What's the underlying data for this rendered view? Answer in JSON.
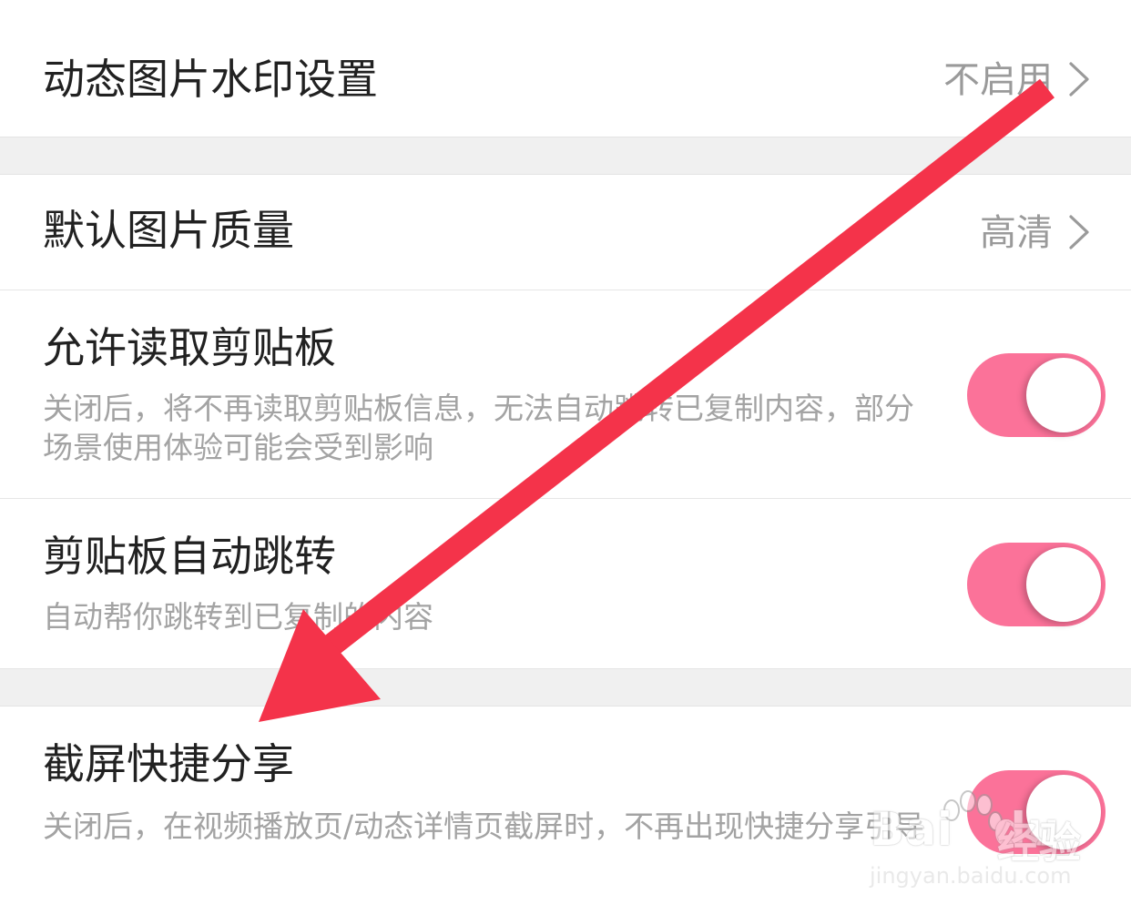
{
  "settings": {
    "watermark_row": {
      "title": "动态图片水印设置",
      "value": "不启用"
    },
    "quality_row": {
      "title": "默认图片质量",
      "value": "高清"
    },
    "clipboard_read": {
      "title": "允许读取剪贴板",
      "description": "关闭后，将不再读取剪贴板信息，无法自动跳转已复制内容，部分场景使用体验可能会受到影响",
      "enabled": true
    },
    "clipboard_jump": {
      "title": "剪贴板自动跳转",
      "description": "自动帮你跳转到已复制的内容",
      "enabled": true
    },
    "screenshot_share": {
      "title": "截屏快捷分享",
      "description": "关闭后，在视频播放页/动态详情页截屏时，不再出现快捷分享引导",
      "enabled": true
    }
  },
  "colors": {
    "toggle_on": "#fb7299",
    "annotation_arrow": "#f4334a",
    "separator": "#f0f0f0"
  },
  "icons": {
    "row_chevron": "chevron-right-icon"
  },
  "watermark": {
    "brand": "Bai",
    "brand_suffix": "du",
    "cn": "经验",
    "url": "jingyan.baidu.com"
  }
}
